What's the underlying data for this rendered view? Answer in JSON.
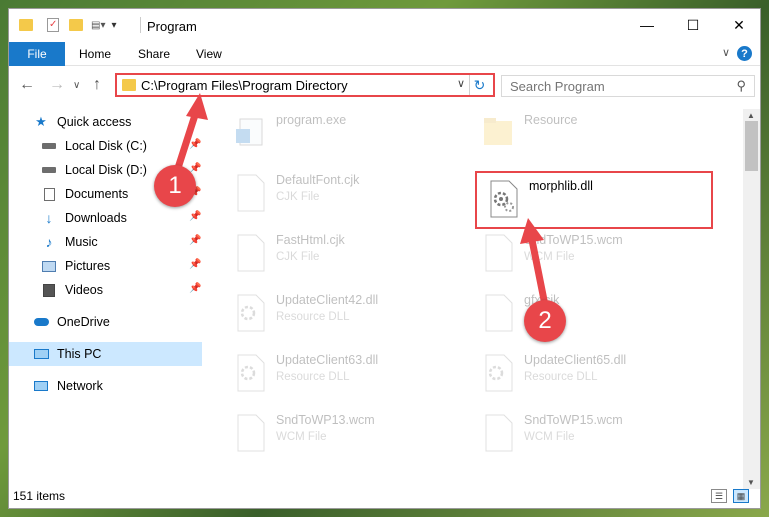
{
  "window": {
    "title": "Program",
    "controls": {
      "minimize": "—",
      "maximize": "☐",
      "close": "✕"
    }
  },
  "ribbon": {
    "tabs": [
      "File",
      "Home",
      "Share",
      "View"
    ],
    "help": "?"
  },
  "address": {
    "path": "C:\\Program Files\\Program Directory",
    "search_placeholder": "Search Program"
  },
  "sidebar": {
    "items": [
      {
        "label": "Quick access",
        "icon": "star-icon",
        "pinned": false
      },
      {
        "label": "Local Disk (C:)",
        "icon": "drive-icon",
        "pinned": true
      },
      {
        "label": "Local Disk (D:)",
        "icon": "drive-icon",
        "pinned": true
      },
      {
        "label": "Documents",
        "icon": "documents-icon",
        "pinned": true
      },
      {
        "label": "Downloads",
        "icon": "download-icon",
        "pinned": true
      },
      {
        "label": "Music",
        "icon": "music-icon",
        "pinned": true
      },
      {
        "label": "Pictures",
        "icon": "pictures-icon",
        "pinned": true
      },
      {
        "label": "Videos",
        "icon": "videos-icon",
        "pinned": true
      },
      {
        "label": "OneDrive",
        "icon": "cloud-icon",
        "pinned": false
      },
      {
        "label": "This PC",
        "icon": "computer-icon",
        "pinned": false,
        "selected": true
      },
      {
        "label": "Network",
        "icon": "network-icon",
        "pinned": false
      }
    ]
  },
  "files": [
    {
      "name": "program.exe",
      "type": "",
      "icon": "exe-icon"
    },
    {
      "name": "Resource",
      "type": "",
      "icon": "folder-icon"
    },
    {
      "name": "DefaultFont.cjk",
      "type": "CJK File",
      "icon": "file-icon"
    },
    {
      "name": "morphlib.dll",
      "type": "",
      "icon": "dll-gear-icon",
      "highlighted": true
    },
    {
      "name": "FastHtml.cjk",
      "type": "CJK File",
      "icon": "file-icon"
    },
    {
      "name": "SndToWP15.wcm",
      "type": "WCM File",
      "icon": "file-icon"
    },
    {
      "name": "UpdateClient42.dll",
      "type": "Resource DLL",
      "icon": "dll-gear-icon"
    },
    {
      "name": "gfx.cjk",
      "type": "",
      "icon": "file-icon"
    },
    {
      "name": "UpdateClient63.dll",
      "type": "Resource DLL",
      "icon": "dll-gear-icon"
    },
    {
      "name": "UpdateClient65.dll",
      "type": "Resource DLL",
      "icon": "dll-gear-icon"
    },
    {
      "name": "SndToWP13.wcm",
      "type": "WCM File",
      "icon": "file-icon"
    },
    {
      "name": "SndToWP15.wcm",
      "type": "WCM File",
      "icon": "file-icon"
    }
  ],
  "status": {
    "item_count": "151 items"
  },
  "annotations": {
    "step1": "1",
    "step2": "2",
    "color": "#e8464a"
  }
}
